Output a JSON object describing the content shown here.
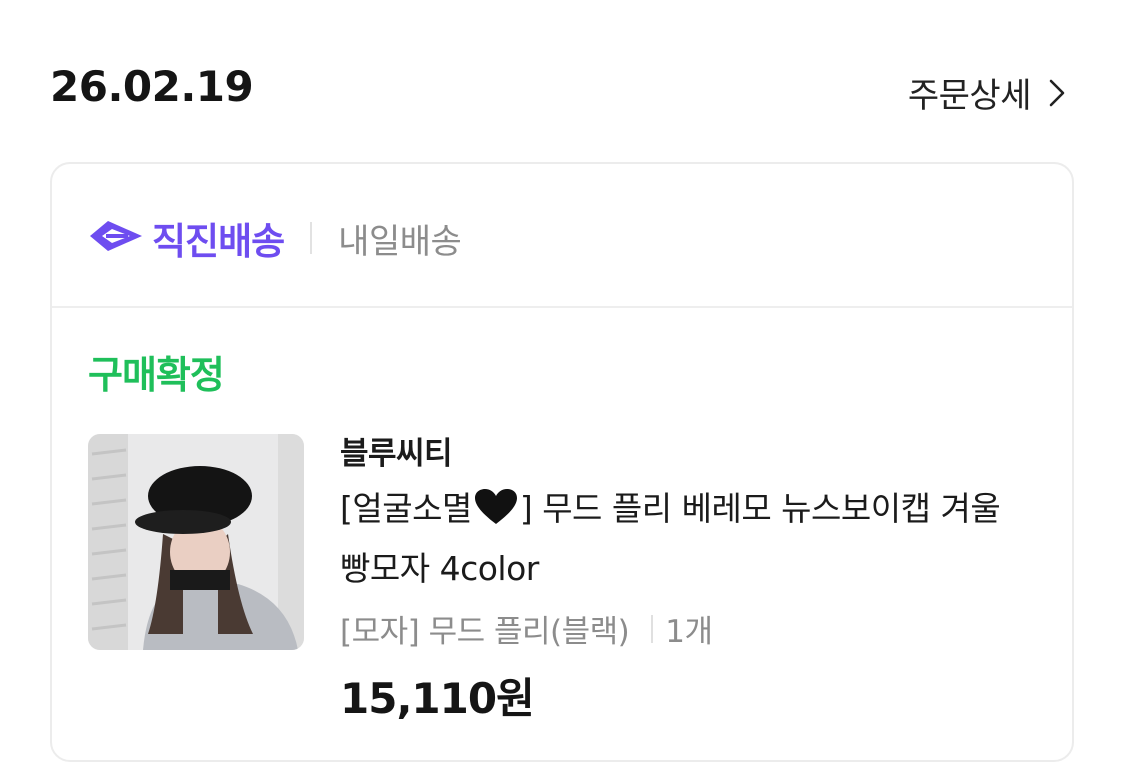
{
  "order": {
    "date": "26.02.19",
    "detail_label": "주문상세"
  },
  "delivery": {
    "brand": "직진배송",
    "type": "내일배송"
  },
  "status": {
    "label": "구매확정",
    "color": "#1fbf5a"
  },
  "product": {
    "store": "블루씨티",
    "title_prefix": "[얼굴소멸",
    "title_suffix": "] 무드 플리 베레모 뉴스보이캡 겨울 빵모자 4color",
    "option": "[모자] 무드 플리(블랙)",
    "quantity": "1개",
    "price": "15,110원"
  },
  "icons": {
    "detail": "chevron-right-icon",
    "delivery": "zigzin-arrow-icon",
    "title_emoji": "black-heart-icon"
  },
  "colors": {
    "brand_purple": "#6e4df0",
    "status_green": "#1fbf5a",
    "muted_text": "#8c8c8c"
  }
}
